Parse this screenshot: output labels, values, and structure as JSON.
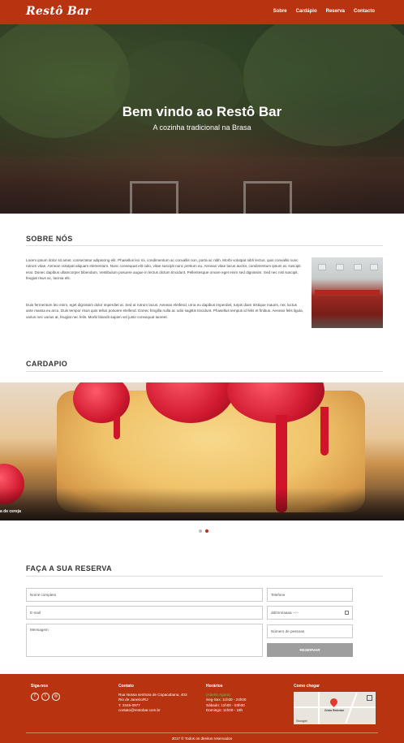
{
  "navbar": {
    "brand": "Restô Bar",
    "items": [
      {
        "label": "Sobre"
      },
      {
        "label": "Cardápio"
      },
      {
        "label": "Reserva"
      },
      {
        "label": "Contacto"
      }
    ]
  },
  "hero": {
    "title": "Bem vindo ao Restô Bar",
    "subtitle": "A cozinha tradicional na Brasa"
  },
  "about": {
    "title": "SOBRE NÓS",
    "paragraph1": "Lorem ipsum dolor sit amet, consectetur adipiscing elit. Phasellus leo mi, condimentum ac convallis non, porta ac nibh. Morbi volutpat nibh lectus, quis convallis nunc rutrum vitae. Aenean volutpat aliquam elementum. Nunc consequat elit odio, vitae suscipit nunc pretium eu. Aenean vitae lacus auctor, condimentum ipsum at, suscipit erat. Donec dapibus ullamcorper bibendum. Vestibulum posuere augue in lectus dictum tincidunt. Pellentesque ornare eget enim sed dignissim. Sed nec nisl suscipit, feugiat risus ac, lacinia elit.",
    "paragraph2": "Duis fermentum leo enim, eget dignissim dolor imperdiet at. Sed ut rutrum lacus. Aenean eleifend, urna eu dapibus imperdiet, turpis diam tristique mauris, nec luctus ante massa eu arcu. Duis tempor risus quis tellus posuere eleifend. Donec fringilla nulla ac odio sagittis tincidunt. Phasellus tempus id felis et finibus. Aenean felis ligula, varius nec varius at, feugiat nec felis. Morbi blandit sapien vel justo consequat laoreet."
  },
  "menu": {
    "title": "CARDAPIO",
    "caption": "a de cereja",
    "slides": 2,
    "active_slide": 2
  },
  "reservation": {
    "title": "FAÇA A SUA RESERVA",
    "name_placeholder": "Nome completo",
    "phone_placeholder": "Telefone",
    "email_placeholder": "E-mail",
    "date_placeholder": "dd/mm/aaaa --:--",
    "message_placeholder": "Mensagem",
    "people_placeholder": "Número de pessoas",
    "submit_label": "RESERVAR"
  },
  "footer": {
    "social_title": "Siga-nos",
    "social_icons": [
      "f",
      "t",
      "◎"
    ],
    "contact_title": "Contato",
    "address1": "Rua Nossa senhora de Copacabana, 403",
    "address2": "Rio de Janeiro/RJ",
    "phone": "T. 2345-0977",
    "email": "contato@restobar.com.br",
    "hours_title": "Horários",
    "hours_status": "(Aberto Agora)",
    "hours1": "Seg-Sex: 11h30 - 24h00",
    "hours2": "Sábado: 11h00 - 03h00",
    "hours3": "Domingo: 11h00 - 18h",
    "map_title": "Como chegar",
    "map_pin_label": "Cristo Redentor",
    "map_logo": "Google",
    "copyright": "2017 © Todos os direitos reservados"
  },
  "colors": {
    "brand": "#b83310",
    "button_gray": "#9e9e9e",
    "status_open": "#4fd24f"
  }
}
